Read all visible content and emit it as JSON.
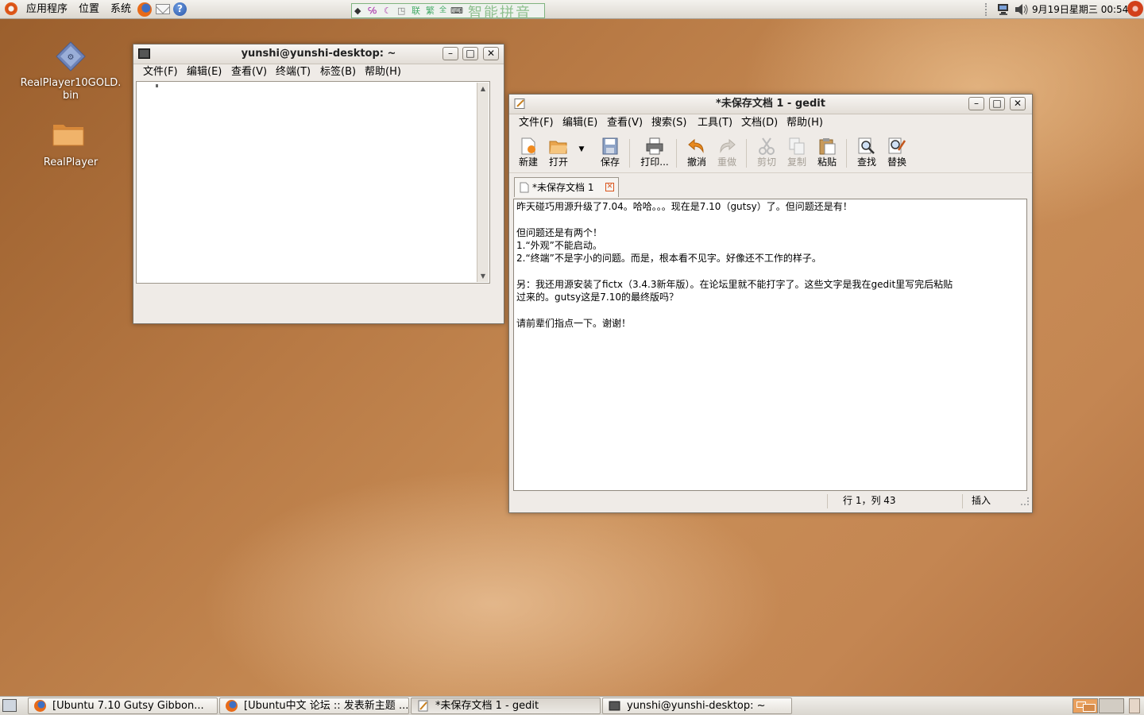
{
  "top_panel": {
    "menu_applications": "应用程序",
    "menu_places": "位置",
    "menu_system": "系统",
    "ime": {
      "seg1": "联",
      "seg2": "繁",
      "seg3": "全",
      "big": "智能拼音"
    },
    "clock": "9月19日星期三 00:54",
    "icons": [
      "ubuntu-logo-icon",
      "firefox-icon",
      "mail-icon",
      "help-icon",
      "network-icon",
      "volume-icon",
      "quit-icon"
    ]
  },
  "desktop": {
    "icons": [
      {
        "label_line1": "RealPlayer10GOLD.",
        "label_line2": "bin"
      },
      {
        "label_line1": "RealPlayer"
      }
    ]
  },
  "terminal": {
    "title": "yunshi@yunshi-desktop: ~",
    "menu": [
      "文件(F)",
      "编辑(E)",
      "查看(V)",
      "终端(T)",
      "标签(B)",
      "帮助(H)"
    ]
  },
  "gedit": {
    "title": "*未保存文档 1 - gedit",
    "menu": [
      "文件(F)",
      "编辑(E)",
      "查看(V)",
      "搜索(S)",
      "工具(T)",
      "文档(D)",
      "帮助(H)"
    ],
    "toolbar": {
      "new": "新建",
      "open": "打开",
      "save": "保存",
      "print": "打印...",
      "undo": "撤消",
      "redo": "重做",
      "cut": "剪切",
      "copy": "复制",
      "paste": "粘贴",
      "find": "查找",
      "replace": "替换"
    },
    "tab_label": "*未保存文档 1",
    "content": [
      "昨天碰巧用源升级了7.04。哈哈。。。现在是7.10（gutsy）了。但问题还是有！",
      "",
      "但问题还是有两个！",
      "1.“外观”不能启动。",
      "2.“终端”不是字小的问题。而是，根本看不见字。好像还不工作的样子。",
      "",
      "另：我还用源安装了fictx（3.4.3新年版）。在论坛里就不能打字了。这些文字是我在gedit里写完后粘贴",
      "过来的。gutsy这是7.10的最终版吗？",
      "",
      "请前辈们指点一下。谢谢！"
    ],
    "status": {
      "position": "行 1，列 43",
      "mode": "插入"
    }
  },
  "taskbar": {
    "tasks": [
      "[Ubuntu 7.10 Gutsy Gibbon...",
      "[Ubuntu中文 论坛 :: 发表新主题 ...",
      "*未保存文档 1 - gedit",
      "yunshi@yunshi-desktop: ~"
    ]
  }
}
